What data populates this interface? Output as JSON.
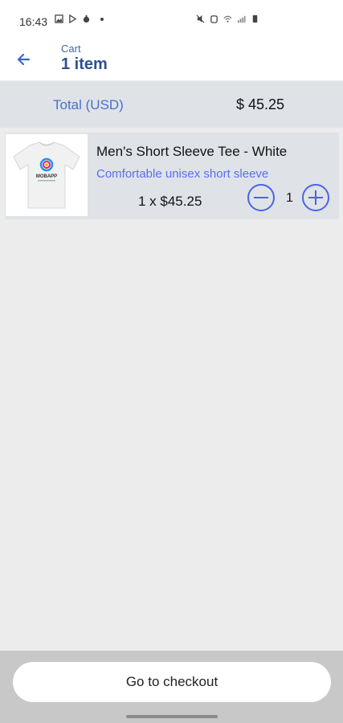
{
  "status_bar": {
    "time": "16:43"
  },
  "header": {
    "subtitle": "Cart",
    "title": "1 item"
  },
  "total": {
    "label": "Total (USD)",
    "value": "$ 45.25"
  },
  "cart_items": [
    {
      "name": "Men's Short Sleeve Tee - White",
      "description": "Comfortable unisex short sleeve",
      "price_line": "1 x $45.25",
      "quantity": "1",
      "thumbnail_logo_text": "MOBAPP"
    }
  ],
  "footer": {
    "checkout_label": "Go to checkout"
  },
  "colors": {
    "accent": "#4a63e8",
    "header_text": "#2f4f8f",
    "total_label": "#4a6fcf"
  }
}
